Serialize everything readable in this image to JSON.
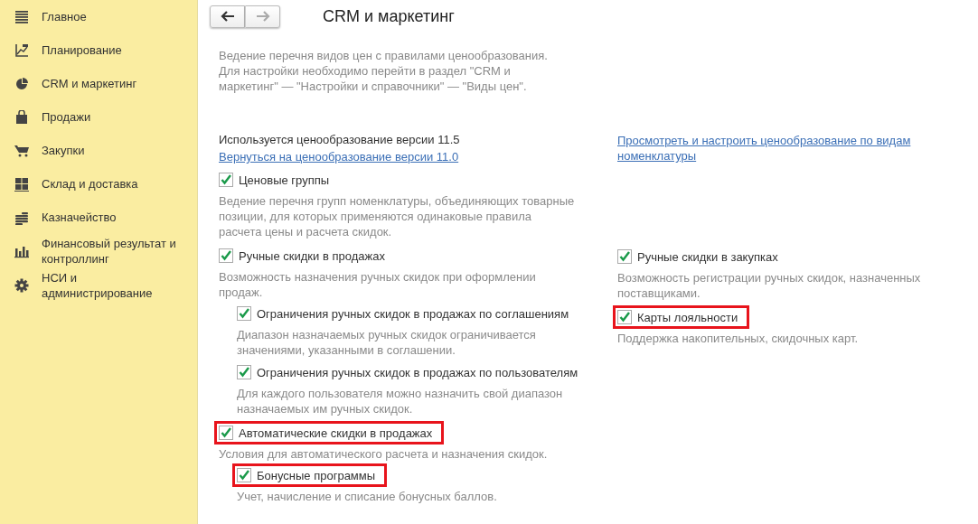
{
  "sidebar": {
    "items": [
      {
        "label": "Главное"
      },
      {
        "label": "Планирование"
      },
      {
        "label": "CRM и маркетинг"
      },
      {
        "label": "Продажи"
      },
      {
        "label": "Закупки"
      },
      {
        "label": "Склад и доставка"
      },
      {
        "label": "Казначейство"
      },
      {
        "label": "Финансовый результат и контроллинг"
      },
      {
        "label": "НСИ и администрирование"
      }
    ]
  },
  "nav": {
    "back": {
      "disabled": false
    },
    "forward": {
      "disabled": true
    }
  },
  "title": "CRM и маркетинг",
  "intro": [
    "Ведение перечня видов цен с правилами ценообразования.",
    "Для настройки необходимо перейти в раздел \"CRM и маркетинг\" — \"Настройки и справочники\" — \"Виды цен\"."
  ],
  "pricing": {
    "status": "Используется ценообразование версии 11.5",
    "link": "Вернуться на ценообразование версии 11.0"
  },
  "right_link": "Просмотреть и настроить ценообразование по видам номенклатуры",
  "left_options": [
    {
      "label": "Ценовые группы",
      "checked": true,
      "highlighted": false,
      "description": "Ведение перечня групп номенклатуры, объединяющих товарные позиции, для которых применяются одинаковые правила расчета цены и расчета скидок."
    },
    {
      "label": "Ручные скидки в продажах",
      "checked": true,
      "highlighted": false,
      "description": "Возможность назначения ручных скидок при оформлении продаж.",
      "children": [
        {
          "label": "Ограничения ручных скидок в продажах по соглашениям",
          "checked": true,
          "highlighted": false,
          "description": "Диапазон назначаемых ручных скидок ограничивается значениями, указанными в соглашении."
        },
        {
          "label": "Ограничения ручных скидок в продажах по пользователям",
          "checked": true,
          "highlighted": false,
          "description": "Для каждого пользователя можно назначить свой диапазон назначаемых им ручных скидок."
        }
      ]
    },
    {
      "label": "Автоматические скидки в продажах",
      "checked": true,
      "highlighted": true,
      "description": "Условия для автоматического расчета и назначения скидок.",
      "children": [
        {
          "label": "Бонусные программы",
          "checked": true,
          "highlighted": true,
          "description": "Учет, начисление и списание бонусных баллов."
        }
      ]
    }
  ],
  "right_options": [
    {
      "label": "Ручные скидки в закупках",
      "checked": true,
      "highlighted": false,
      "description": "Возможность регистрации ручных скидок, назначенных поставщиками."
    },
    {
      "label": "Карты лояльности",
      "checked": true,
      "highlighted": true,
      "description": "Поддержка накопительных, скидочных карт."
    }
  ]
}
